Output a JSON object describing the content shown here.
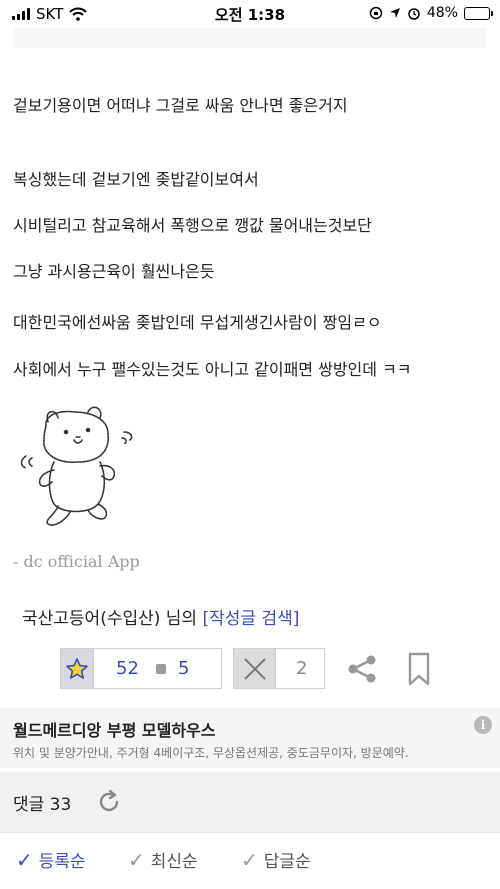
{
  "status_bar": {
    "carrier": "SKT",
    "time": "오전 1:38",
    "battery_percent": "48%",
    "battery_level": 0.48
  },
  "post": {
    "lines": [
      "겉보기용이면 어떠냐 그걸로 싸움 안나면 좋은거지",
      "복싱했는데 겉보기엔 좆밥같이보여서",
      "시비털리고 참교육해서 폭행으로 깽값 물어내는것보단",
      "그냥 과시용근육이 훨씬나은듯",
      "대한민국에선싸움 좆밥인데 무섭게생긴사람이 짱임ㄹㅇ",
      "사회에서 누구 팰수있는것도 아니고 같이패면 쌍방인데 ㅋㅋ"
    ],
    "app_signature": "- dc official App"
  },
  "author": {
    "name": "국산고등어(수입산)",
    "suffix": "님의",
    "search_link": "[작성글 검색]"
  },
  "actions": {
    "recommend_count": "52",
    "fixed_recommend_count": "5",
    "nonrecommend_count": "2"
  },
  "ad": {
    "title": "월드메르디앙 부평 모델하우스",
    "description": "위치 및 분양가안내, 주거형 4베이구조, 무상옵션제공, 중도금무이자, 방문예약."
  },
  "comments": {
    "label": "댓글 33"
  },
  "sort_tabs": [
    {
      "label": "등록순",
      "active": true
    },
    {
      "label": "최신순",
      "active": false
    },
    {
      "label": "답글순",
      "active": false
    }
  ],
  "colors": {
    "accent": "#3b4cb8",
    "ad_background": "#f5f5f8",
    "comments_background": "#f0f0f2"
  },
  "icons": [
    "signal-icon",
    "wifi-icon",
    "rotation-lock-icon",
    "location-icon",
    "alarm-icon",
    "battery-icon",
    "star-icon",
    "x-icon",
    "share-icon",
    "bookmark-icon",
    "info-icon",
    "refresh-icon",
    "check-icon"
  ]
}
